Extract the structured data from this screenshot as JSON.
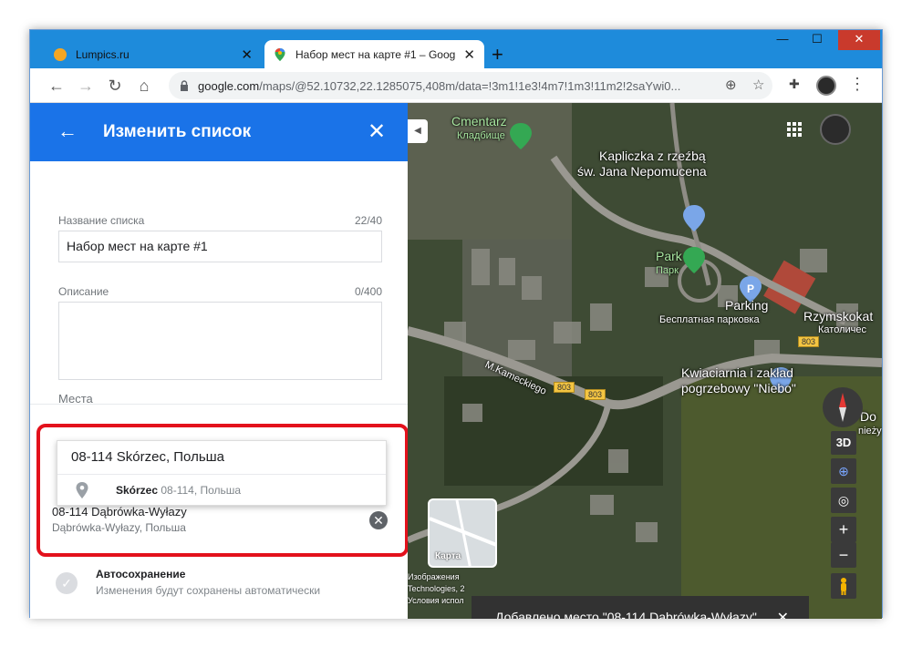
{
  "browser": {
    "tabs": [
      {
        "title": "Lumpics.ru",
        "close": "✕",
        "fav_color": "#f5a623"
      },
      {
        "title": "Набор мест на карте #1 – Goog",
        "close": "✕",
        "fav_color": "#34a853"
      }
    ],
    "new_tab": "+",
    "window_controls": {
      "minimize": "—",
      "maximize": "☐",
      "close": "✕"
    },
    "url_host": "google.com",
    "url_path": "/maps/@52.10732,22.1285075,408m/data=!3m1!1e3!4m7!1m3!11m2!2saYwi0..."
  },
  "panel": {
    "header_title": "Изменить список",
    "back_icon": "←",
    "close_icon": "✕",
    "name_label": "Название списка",
    "name_count": "22/40",
    "name_value": "Набор мест на карте #1",
    "desc_label": "Описание",
    "desc_count": "0/400",
    "desc_value": "",
    "places_label": "Места",
    "search_value": "08-114 Skórzec, Польша",
    "suggestion_main": "Skórzec",
    "suggestion_secondary": " 08-114, Польша",
    "place_name": "08-114 Dąbrówka-Wyłazy",
    "place_address": "Dąbrówka-Wyłazy, Польша",
    "remove_icon": "✕",
    "autosave_title": "Автосохранение",
    "autosave_desc": "Изменения будут сохранены автоматически",
    "highlight_color": "#e3111c"
  },
  "map": {
    "labels": {
      "cemetery": "Cmentarz",
      "cemetery_sub": "Кладбище",
      "chapel_line1": "Kapliczka z rzeźbą",
      "chapel_line2": "św. Jana Nepomucena",
      "park": "Park",
      "park_sub": "Парк",
      "parking": "Parking",
      "parking_sub": "Бесплатная парковка",
      "rzym": "Rzymskokat",
      "rzym_sub": "Католичес",
      "street": "M.Kameckiego",
      "florist_line1": "Kwiaciarnia i zakład",
      "florist_line2": "pogrzebowy \"Niebo\"",
      "road1": "803",
      "road2": "803",
      "road3": "803",
      "edge1": "Do",
      "edge2": "niеży"
    },
    "controls": {
      "threed": "3D",
      "zoom_in": "+",
      "zoom_out": "−"
    },
    "minimap_label": "Карта",
    "attribution": [
      "Изображения",
      "Technologies, 2",
      "Условия испол"
    ],
    "toast_text": "Добавлено место \"08-114 Dąbrówka-Wyłazy\"",
    "toast_close": "✕"
  }
}
